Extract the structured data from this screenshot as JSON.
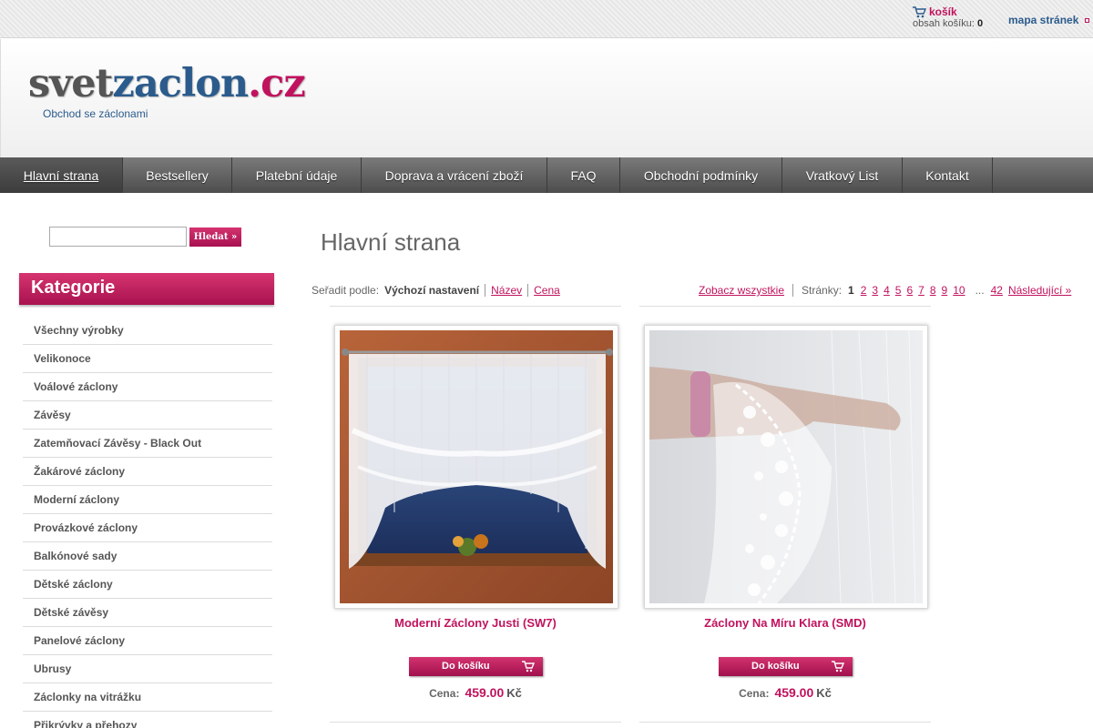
{
  "top": {
    "cart_label": "košík",
    "cart_contents_label": "obsah košíku:",
    "cart_count": "0",
    "sitemap_label": "mapa stránek"
  },
  "header": {
    "logo_part1": "svet",
    "logo_part2": "zaclon",
    "logo_part3": ".cz",
    "tagline": "Obchod se záclonami"
  },
  "nav": {
    "items": [
      "Hlavní strana",
      "Bestsellery",
      "Platební údaje",
      "Doprava a vrácení zboží",
      "FAQ",
      "Obchodní podmínky",
      "Vratkový List",
      "Kontakt"
    ]
  },
  "search": {
    "value": "",
    "button_label": "Hledat »"
  },
  "sidebar": {
    "heading": "Kategorie",
    "categories": [
      "Všechny výrobky",
      "Velikonoce",
      "Voálové záclony",
      "Závěsy",
      "Zatemňovací Závěsy - Black Out",
      "Žakárové záclony",
      "Moderní záclony",
      "Provázkové záclony",
      "Balkónové sady",
      "Dětské záclony",
      "Dětské závěsy",
      "Panelové záclony",
      "Ubrusy",
      "Záclonky na vitrážku",
      "Přikrývky a přehozy"
    ]
  },
  "main": {
    "title": "Hlavní strana",
    "sort": {
      "label": "Seřadit podle:",
      "current": "Výchozí nastavení",
      "by_name": "Název",
      "by_price": "Cena"
    },
    "pager": {
      "view_all": "Zobacz wszystkie",
      "pages_label": "Stránky:",
      "current": "1",
      "pages": [
        "2",
        "3",
        "4",
        "5",
        "6",
        "7",
        "8",
        "9",
        "10"
      ],
      "ellipsis": "...",
      "last": "42",
      "next": "Následující »"
    },
    "products": [
      {
        "name": "Moderní Záclony Justi (SW7)",
        "add_label": "Do košíku",
        "price_label": "Cena:",
        "price": "459.00",
        "currency": "Kč"
      },
      {
        "name": "Záclony Na Míru Klara (SMD)",
        "add_label": "Do košíku",
        "price_label": "Cena:",
        "price": "459.00",
        "currency": "Kč"
      }
    ]
  },
  "colors": {
    "accent": "#c0135e",
    "link_blue": "#2b5b8c",
    "nav_dark": "#4d4d4d"
  }
}
